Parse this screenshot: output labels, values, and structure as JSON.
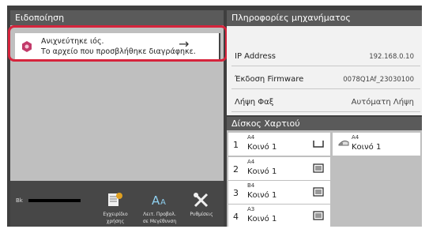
{
  "colors": {
    "highlight": "#d6243c",
    "header_bg": "#5a5a5a",
    "notif_icon": "#c23a6a"
  },
  "notification": {
    "title": "Ειδοποίηση",
    "line1": "Ανιχνεύτηκε ιός.",
    "line2": "Το αρχείο που προσβλήθηκε διαγράφηκε.",
    "arrow": "→",
    "icon": "virus-warning-icon"
  },
  "toolbar": {
    "bk_label": "Bk",
    "manual": {
      "line1": "Εγχειρίδιο",
      "line2": "χρήσης",
      "icon": "manual-book-icon"
    },
    "large_text": {
      "line1": "Λειτ. Προβολ.",
      "line2": "σε Μεγέθυνση",
      "icon": "text-size-icon"
    },
    "settings": {
      "line1": "Ρυθμίσεις",
      "line2": "",
      "icon": "tools-icon"
    }
  },
  "machine_info": {
    "title": "Πληροφορίες μηχανήματος",
    "rows": [
      {
        "key": "IP Address",
        "value": "192.168.0.10"
      },
      {
        "key": "Έκδοση Firmware",
        "value": "0078Q1Af_23030100"
      },
      {
        "key": "Λήψη Φαξ",
        "value": "Αυτόματη Λήψη"
      }
    ]
  },
  "paper_tray": {
    "title": "Δίσκος Χαρτιού",
    "trays": [
      {
        "num": "1",
        "size": "A4",
        "type": "Κοινό 1",
        "icon": "tray-empty-icon"
      },
      {
        "num": "2",
        "size": "A4",
        "type": "Κοινό 1",
        "icon": "tray-level-icon"
      },
      {
        "num": "3",
        "size": "B4",
        "type": "Κοινό 1",
        "icon": "tray-level-icon"
      },
      {
        "num": "4",
        "size": "A3",
        "type": "Κοινό 1",
        "icon": "tray-level-icon"
      }
    ],
    "bypass": {
      "size": "A4",
      "type": "Κοινό 1",
      "icon": "bypass-tray-icon"
    }
  }
}
